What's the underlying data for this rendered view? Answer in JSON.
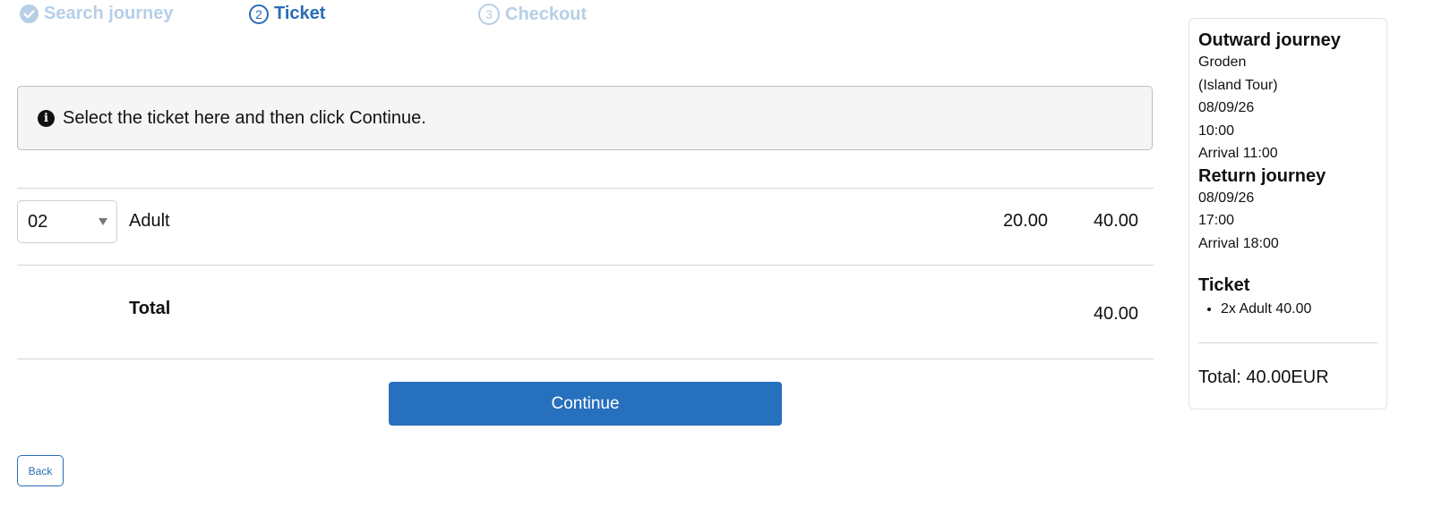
{
  "steps": [
    {
      "label": "Search journey",
      "state": "done",
      "icon": "check-circle-icon"
    },
    {
      "label": "Ticket",
      "state": "active",
      "number": "2"
    },
    {
      "label": "Checkout",
      "state": "upcoming",
      "number": "3"
    }
  ],
  "info": {
    "icon": "info-icon",
    "text": "Select the ticket here and then click Continue."
  },
  "ticket_row": {
    "quantity": "02",
    "label": "Adult",
    "unit_price": "20.00",
    "line_total": "40.00"
  },
  "total_row": {
    "label": "Total",
    "value": "40.00"
  },
  "buttons": {
    "continue": "Continue",
    "back": "Back"
  },
  "summary": {
    "outward": {
      "title": "Outward journey",
      "lines": [
        "Groden",
        "(Island Tour)",
        "08/09/26",
        "10:00",
        "Arrival 11:00"
      ]
    },
    "return": {
      "title": "Return journey",
      "lines": [
        "08/09/26",
        "17:00",
        "Arrival 18:00"
      ]
    },
    "ticket": {
      "title": "Ticket",
      "items": [
        "2x Adult 40.00"
      ]
    },
    "total": "Total: 40.00EUR"
  },
  "colors": {
    "accent": "#2770bd",
    "step_inactive": "#b6cfe6",
    "info_bg": "#f5f5f5"
  }
}
